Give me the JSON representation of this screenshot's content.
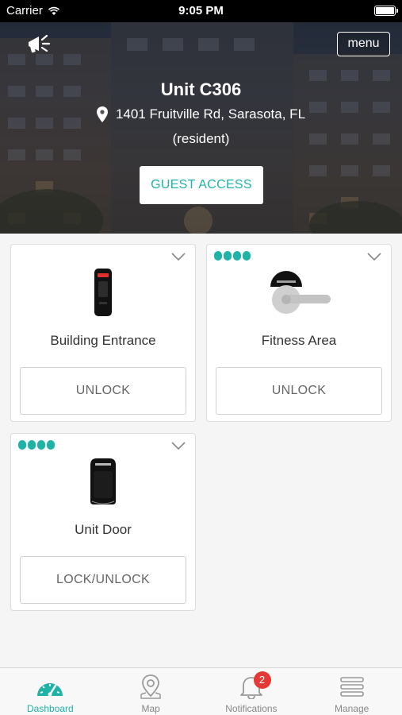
{
  "status_bar": {
    "carrier": "Carrier",
    "time": "9:05 PM"
  },
  "header": {
    "menu_label": "menu",
    "unit_title": "Unit C306",
    "address": "1401 Fruitville Rd, Sarasota, FL",
    "role": "(resident)",
    "guest_access_label": "GUEST ACCESS"
  },
  "devices": [
    {
      "name": "Building Entrance",
      "action_label": "UNLOCK",
      "icon": "card-reader-icon",
      "battery_level": null
    },
    {
      "name": "Fitness Area",
      "action_label": "UNLOCK",
      "icon": "lever-lock-icon",
      "battery_level": 4
    },
    {
      "name": "Unit Door",
      "action_label": "LOCK/UNLOCK",
      "icon": "deadbolt-lock-icon",
      "battery_level": 4
    }
  ],
  "tab_bar": {
    "tabs": [
      {
        "label": "Dashboard",
        "icon": "dashboard-icon",
        "active": true
      },
      {
        "label": "Map",
        "icon": "map-pin-icon",
        "active": false
      },
      {
        "label": "Notifications",
        "icon": "bell-icon",
        "active": false,
        "badge": "2"
      },
      {
        "label": "Manage",
        "icon": "manage-icon",
        "active": false
      }
    ]
  },
  "colors": {
    "accent": "#1fb3a8",
    "badge": "#e53935",
    "background": "#f5f5f5"
  }
}
